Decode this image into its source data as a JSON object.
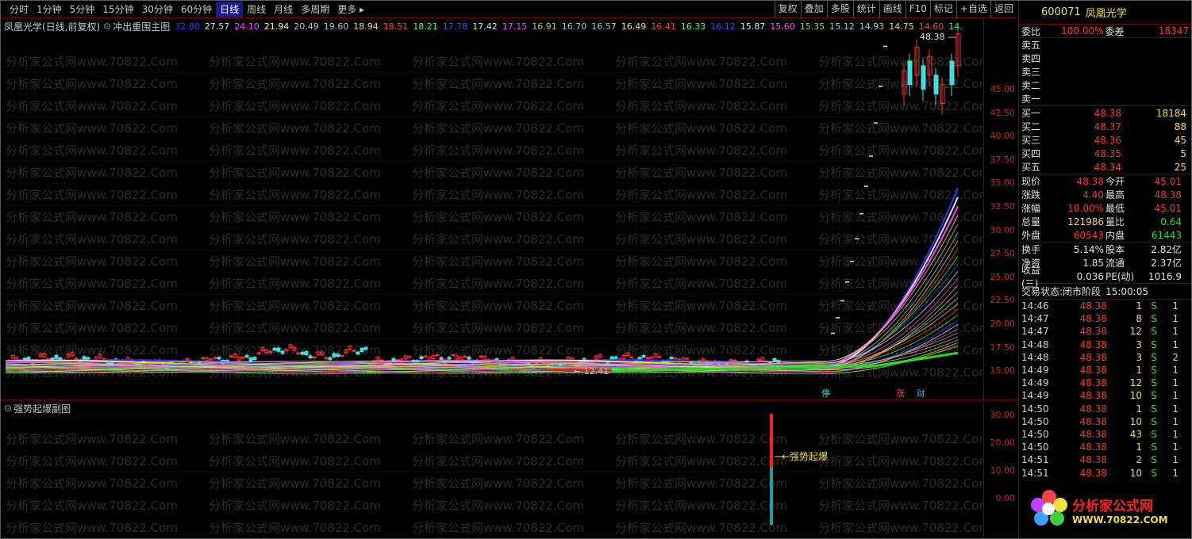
{
  "toolbar": {
    "periods": [
      "分时",
      "1分钟",
      "5分钟",
      "15分钟",
      "30分钟",
      "60分钟",
      "日线",
      "周线",
      "月线",
      "多周期",
      "更多"
    ],
    "active_period": "日线",
    "right_buttons": [
      "复权",
      "叠加",
      "多股",
      "统计",
      "画线",
      "F10",
      "标记",
      "+自选",
      "返回"
    ]
  },
  "main_pane": {
    "title": "凤凰光学(日线,前复权)",
    "indicator": "冲出重围主图",
    "ma_values": [
      "32.88",
      "27.57",
      "24.10",
      "21.94",
      "20.49",
      "19.60",
      "18.94",
      "18.51",
      "18.21",
      "17.78",
      "17.42",
      "17.15",
      "16.91",
      "16.70",
      "16.57",
      "16.49",
      "16.41",
      "16.33",
      "16.12",
      "15.87",
      "15.60",
      "15.35",
      "15.12",
      "14.93",
      "14.75",
      "14.60",
      "14."
    ],
    "ma_colors": [
      "#3030ff",
      "#e0e0e0",
      "#ff40ff",
      "#ffff40",
      "#c0c0c0",
      "#c0c0c0",
      "#f0e040",
      "#ff4040",
      "#40ff40",
      "#3050ff",
      "#e0e0e0",
      "#ff40ff",
      "#c0c040",
      "#c0c0c0",
      "#c0c0c0",
      "#f0e040",
      "#ff4040",
      "#40ff40",
      "#3050ff",
      "#e0e0e0",
      "#ff40ff",
      "#c0c040",
      "#c0c0c0",
      "#c0c0c0",
      "#f0e040",
      "#ff4040",
      "#40ff40"
    ],
    "high_label": "48.38",
    "low_label": "12.41",
    "markers": [
      "停",
      "涨",
      "财"
    ],
    "yaxis": [
      "45.00",
      "42.50",
      "40.00",
      "37.50",
      "35.00",
      "32.50",
      "30.00",
      "27.50",
      "25.00",
      "22.50",
      "20.00",
      "17.50",
      "15.00"
    ]
  },
  "sub_pane": {
    "title": "强势起爆副图",
    "signal_label": "强势起爆",
    "yaxis": [
      "30.00",
      "20.00",
      "10.00",
      "0.00"
    ]
  },
  "quote": {
    "code": "600071",
    "name": "凤凰光学",
    "ratio_label": "委比",
    "ratio_value": "100.00%",
    "diff_label": "委差",
    "diff_value": "18347",
    "asks": [
      {
        "label": "卖五",
        "price": "",
        "vol": ""
      },
      {
        "label": "卖四",
        "price": "",
        "vol": ""
      },
      {
        "label": "卖三",
        "price": "",
        "vol": ""
      },
      {
        "label": "卖二",
        "price": "",
        "vol": ""
      },
      {
        "label": "卖一",
        "price": "",
        "vol": ""
      }
    ],
    "bids": [
      {
        "label": "买一",
        "price": "48.38",
        "vol": "18184"
      },
      {
        "label": "买二",
        "price": "48.37",
        "vol": "88"
      },
      {
        "label": "买三",
        "price": "48.36",
        "vol": "45"
      },
      {
        "label": "买四",
        "price": "48.35",
        "vol": "5"
      },
      {
        "label": "买五",
        "price": "48.34",
        "vol": "25"
      }
    ],
    "stats_a": [
      {
        "l1": "现价",
        "v1": "48.38",
        "c1": "c-red",
        "l2": "今开",
        "v2": "45.01",
        "c2": "c-red"
      },
      {
        "l1": "涨跌",
        "v1": "4.40",
        "c1": "c-red",
        "l2": "最高",
        "v2": "48.38",
        "c2": "c-red"
      },
      {
        "l1": "涨幅",
        "v1": "10.00%",
        "c1": "c-red",
        "l2": "最低",
        "v2": "45.01",
        "c2": "c-red"
      },
      {
        "l1": "总量",
        "v1": "121986",
        "c1": "c-yel",
        "l2": "量比",
        "v2": "0.64",
        "c2": "c-grn"
      },
      {
        "l1": "外盘",
        "v1": "60543",
        "c1": "c-red",
        "l2": "内盘",
        "v2": "61443",
        "c2": "c-grn"
      }
    ],
    "stats_b": [
      {
        "l1": "换手",
        "v1": "5.14%",
        "c1": "c-wht",
        "l2": "股本",
        "v2": "2.82亿",
        "c2": "c-wht"
      },
      {
        "l1": "净资",
        "v1": "1.85",
        "c1": "c-wht",
        "l2": "流通",
        "v2": "2.37亿",
        "c2": "c-wht"
      },
      {
        "l1": "收益(三)",
        "v1": "0.036",
        "c1": "c-wht",
        "l2": "PE(动)",
        "v2": "1016.9",
        "c2": "c-wht"
      }
    ],
    "status_label": "交易状态:",
    "status_value": "闭市阶段",
    "status_time": "15:00:05",
    "ticks": [
      {
        "t": "14:46",
        "p": "48.38",
        "v": "1",
        "s": "S",
        "n": "1"
      },
      {
        "t": "14:47",
        "p": "48.38",
        "v": "8",
        "s": "S",
        "n": "1"
      },
      {
        "t": "14:47",
        "p": "48.38",
        "v": "12",
        "s": "S",
        "n": "1"
      },
      {
        "t": "14:48",
        "p": "48.38",
        "v": "3",
        "s": "S",
        "n": "1"
      },
      {
        "t": "14:48",
        "p": "48.38",
        "v": "3",
        "s": "S",
        "n": "2"
      },
      {
        "t": "14:49",
        "p": "48.38",
        "v": "1",
        "s": "S",
        "n": "1"
      },
      {
        "t": "14:49",
        "p": "48.38",
        "v": "12",
        "s": "S",
        "n": "1"
      },
      {
        "t": "14:49",
        "p": "48.38",
        "v": "10",
        "s": "S",
        "n": "1"
      },
      {
        "t": "14:50",
        "p": "48.38",
        "v": "1",
        "s": "S",
        "n": "1"
      },
      {
        "t": "14:50",
        "p": "48.38",
        "v": "10",
        "s": "S",
        "n": "1"
      },
      {
        "t": "14:50",
        "p": "48.38",
        "v": "43",
        "s": "S",
        "n": "1"
      },
      {
        "t": "14:50",
        "p": "48.38",
        "v": "1",
        "s": "S",
        "n": "1"
      },
      {
        "t": "14:51",
        "p": "48.38",
        "v": "2",
        "s": "S",
        "n": "1"
      },
      {
        "t": "14:51",
        "p": "48.38",
        "v": "10",
        "s": "S",
        "n": "1"
      }
    ]
  },
  "watermark": "分析家公式网www.70822.Com",
  "logo": {
    "title": "分析家公式网",
    "url": "WWW.70822.COM"
  },
  "colors": {
    "up": "#ff3030",
    "down": "#40e0e0",
    "grid": "#7a0000"
  }
}
